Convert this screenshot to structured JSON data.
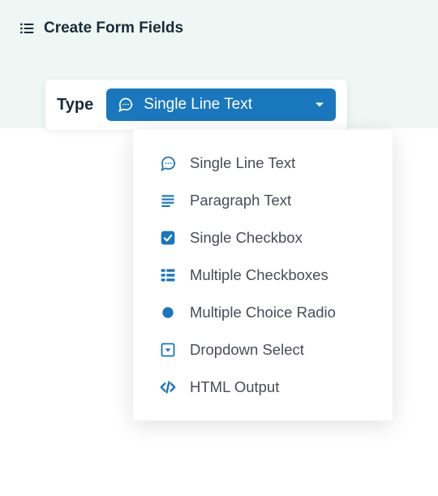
{
  "colors": {
    "accent": "#1977bd",
    "text": "#484c56",
    "heading": "#1a2b3c",
    "bgTint": "#eef7f4"
  },
  "header": {
    "title": "Create Form Fields"
  },
  "type": {
    "label": "Type",
    "selected": {
      "icon": "chat-icon",
      "label": "Single Line Text"
    },
    "options": [
      {
        "icon": "chat-icon",
        "label": "Single Line Text"
      },
      {
        "icon": "lines-icon",
        "label": "Paragraph Text"
      },
      {
        "icon": "checkbox-icon",
        "label": "Single Checkbox"
      },
      {
        "icon": "grid-icon",
        "label": "Multiple Checkboxes"
      },
      {
        "icon": "circle-icon",
        "label": "Multiple Choice Radio"
      },
      {
        "icon": "dropdown-icon",
        "label": "Dropdown Select"
      },
      {
        "icon": "code-icon",
        "label": "HTML Output"
      }
    ]
  }
}
